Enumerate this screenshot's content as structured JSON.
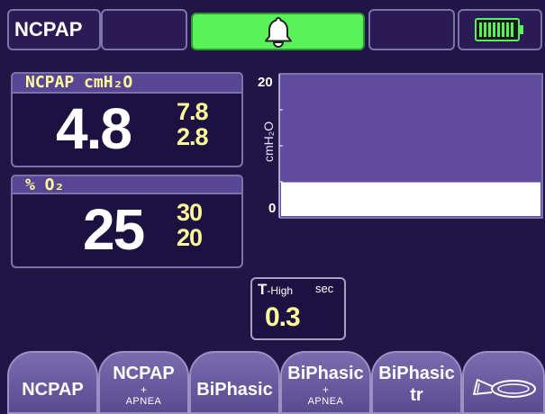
{
  "header": {
    "mode_label": "NCPAP",
    "alarm_icon": "bell-icon",
    "battery_icon": "battery-icon",
    "alarm_color": "#59f25a",
    "battery_color": "#59f25a"
  },
  "pressure": {
    "title": "NCPAP cmH₂O",
    "value": "4.8",
    "limit_high": "7.8",
    "limit_low": "2.8"
  },
  "oxygen": {
    "title": "% O₂",
    "value": "25",
    "limit_high": "30",
    "limit_low": "20"
  },
  "chart_data": {
    "type": "area",
    "ylabel": "cmH₂O",
    "ylim": [
      0,
      20
    ],
    "tick_labels": [
      "20",
      "0"
    ],
    "values": [
      4.8
    ]
  },
  "t_high": {
    "label_main": "T",
    "label_sub": "-High",
    "unit": "sec",
    "value": "0.3"
  },
  "tabs": [
    {
      "label": "NCPAP"
    },
    {
      "label": "NCPAP",
      "plus": "+",
      "sub": "APNEA"
    },
    {
      "label": "BiPhasic"
    },
    {
      "label": "BiPhasic",
      "plus": "+",
      "sub": "APNEA"
    },
    {
      "label": "BiPhasic",
      "line2": "tr"
    },
    {
      "icon": "nasal-mask-icon"
    }
  ]
}
